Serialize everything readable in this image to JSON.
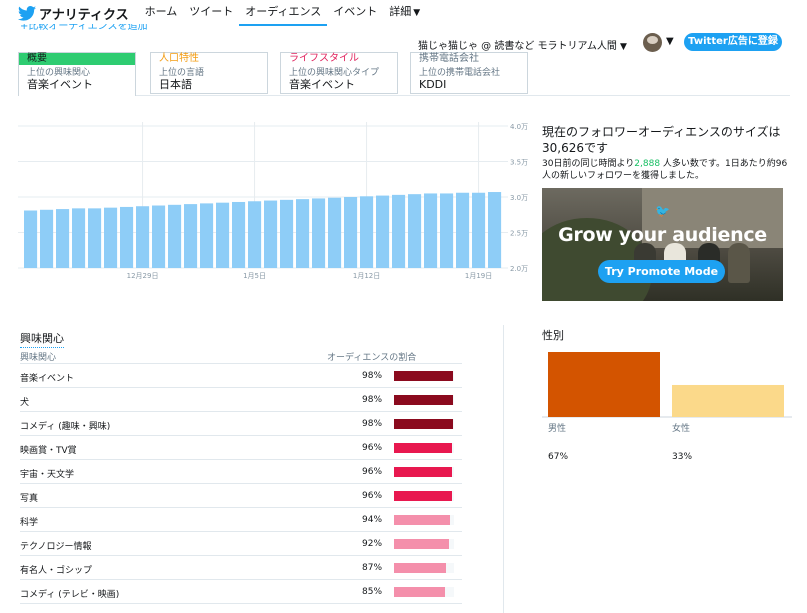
{
  "nav": {
    "brand": "アナリティクス",
    "items": [
      "ホーム",
      "ツイート",
      "オーディエンス",
      "イベント",
      "詳細"
    ],
    "active": "オーディエンス",
    "more_icon": "chevron-down-icon"
  },
  "add_comparison": "+比較オーディエンスを追加",
  "account": {
    "name": "猫じゃ猫じゃ @ 読書など モラトリアム人間",
    "ads_button": "Twitter広告に登録"
  },
  "tabs": [
    {
      "header": "概要",
      "sub": "上位の興味関心",
      "value": "音楽イベント"
    },
    {
      "header": "人口特性",
      "sub": "上位の言語",
      "value": "日本語"
    },
    {
      "header": "ライフスタイル",
      "sub": "上位の興味関心タイプ",
      "value": "音楽イベント"
    },
    {
      "header": "携帯電話会社",
      "sub": "上位の携帯電話会社",
      "value": "KDDI"
    }
  ],
  "chart_data": [
    {
      "type": "bar",
      "values": [
        2.81,
        2.82,
        2.83,
        2.84,
        2.84,
        2.85,
        2.86,
        2.87,
        2.88,
        2.89,
        2.9,
        2.91,
        2.92,
        2.93,
        2.94,
        2.95,
        2.96,
        2.97,
        2.98,
        2.99,
        3.0,
        3.01,
        3.02,
        3.03,
        3.04,
        3.05,
        3.05,
        3.06,
        3.06,
        3.07
      ],
      "x_ticks": [
        {
          "index": 7,
          "label": "12月29日"
        },
        {
          "index": 14,
          "label": "1月5日"
        },
        {
          "index": 21,
          "label": "1月12日"
        },
        {
          "index": 28,
          "label": "1月19日"
        }
      ],
      "ylim": [
        2.0,
        4.0
      ],
      "y_ticks": [
        "2.0万",
        "2.5万",
        "3.0万",
        "3.5万",
        "4.0万"
      ],
      "color": "#8ecdf7"
    },
    {
      "type": "bar",
      "title": "性別",
      "categories": [
        "男性",
        "女性"
      ],
      "values": [
        67,
        33
      ],
      "labels": [
        "67%",
        "33%"
      ],
      "colors": [
        "#d35400",
        "#fbd98a"
      ]
    }
  ],
  "size_panel": {
    "title": "現在のフォロワーオーディエンスのサイズは30,626です",
    "desc_pre": "30日前の同じ時間より",
    "desc_num": "2,888",
    "desc_post": " 人多い数です。1日あたり約96人の新しいフォロワーを獲得しました。"
  },
  "promo": {
    "headline": "Grow your audience",
    "button": "Try Promote Mode"
  },
  "interests": {
    "title": "興味関心",
    "col1": "興味関心",
    "col2": "オーディエンスの割合",
    "rows": [
      {
        "name": "音楽イベント",
        "pct": "98%",
        "value": 98,
        "color": "#8b0a1e"
      },
      {
        "name": "犬",
        "pct": "98%",
        "value": 98,
        "color": "#8b0a1e"
      },
      {
        "name": "コメディ (趣味・興味)",
        "pct": "98%",
        "value": 98,
        "color": "#8b0a1e"
      },
      {
        "name": "映画賞・TV賞",
        "pct": "96%",
        "value": 96,
        "color": "#e8184f"
      },
      {
        "name": "宇宙・天文学",
        "pct": "96%",
        "value": 96,
        "color": "#e8184f"
      },
      {
        "name": "写真",
        "pct": "96%",
        "value": 96,
        "color": "#e8184f"
      },
      {
        "name": "科学",
        "pct": "94%",
        "value": 94,
        "color": "#f48fab"
      },
      {
        "name": "テクノロジー情報",
        "pct": "92%",
        "value": 92,
        "color": "#f48fab"
      },
      {
        "name": "有名人・ゴシップ",
        "pct": "87%",
        "value": 87,
        "color": "#f48fab"
      },
      {
        "name": "コメディ (テレビ・映画)",
        "pct": "85%",
        "value": 85,
        "color": "#f48fab"
      }
    ]
  }
}
